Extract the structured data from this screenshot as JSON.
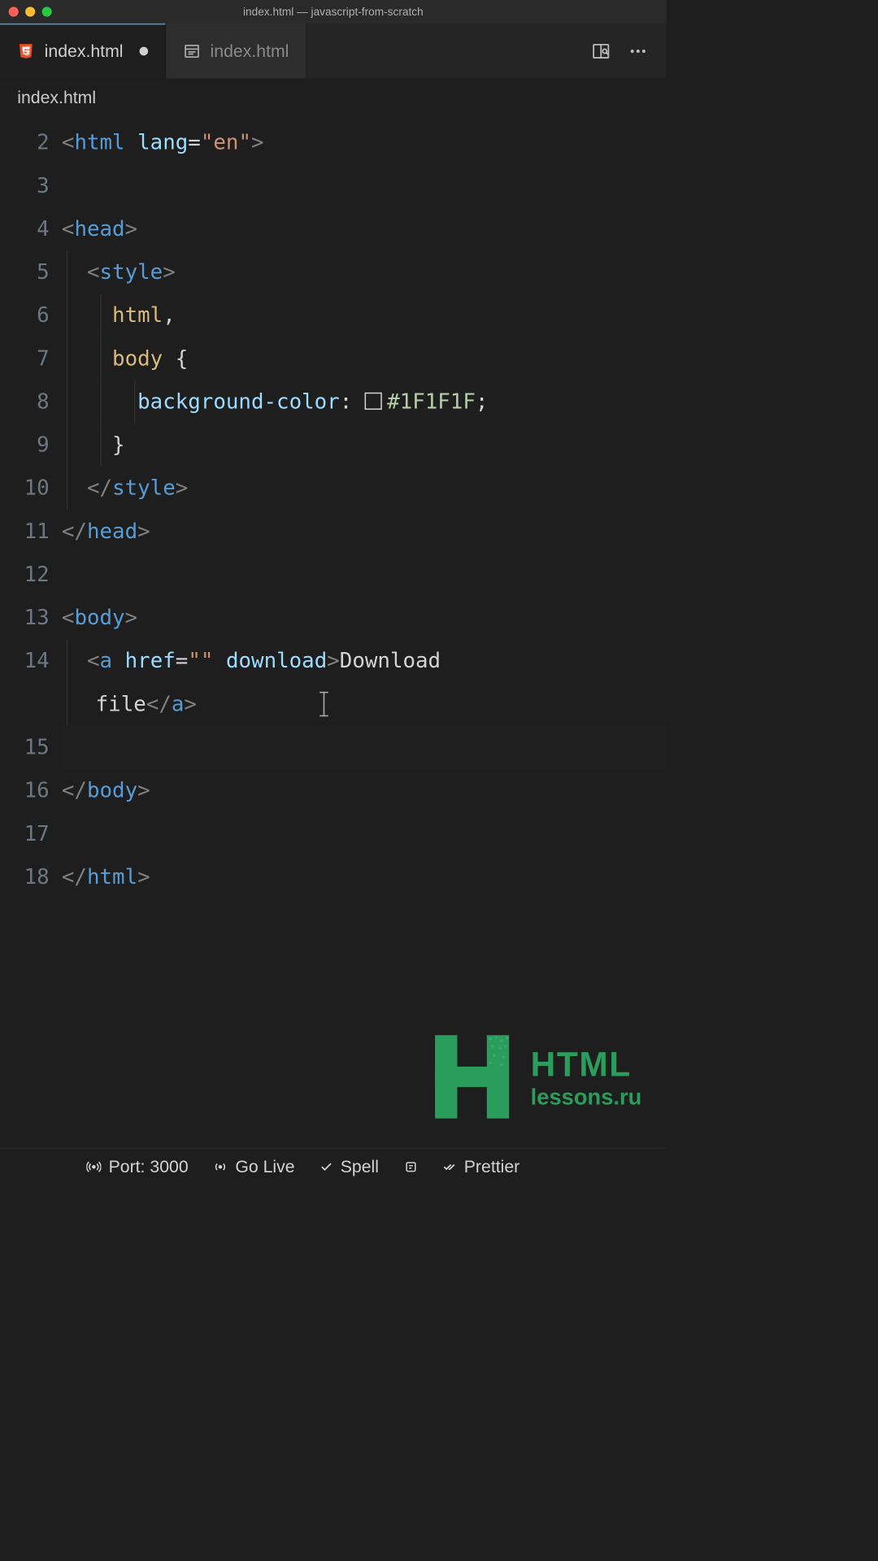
{
  "titlebar": {
    "title": "index.html — javascript-from-scratch"
  },
  "tabs": {
    "items": [
      {
        "label": "index.html",
        "icon": "html5",
        "active": true,
        "dirty": true
      },
      {
        "label": "index.html",
        "icon": "preview",
        "active": false,
        "dirty": false
      }
    ]
  },
  "breadcrumb": {
    "path": "index.html"
  },
  "editor": {
    "line_start": 2,
    "line_count": 17,
    "color_value": "#1F1F1F",
    "code_lines": [
      {
        "num": 2,
        "tokens": [
          {
            "t": "br",
            "v": "<"
          },
          {
            "t": "tag",
            "v": "html"
          },
          {
            "t": "text",
            "v": " "
          },
          {
            "t": "attr",
            "v": "lang"
          },
          {
            "t": "punc",
            "v": "="
          },
          {
            "t": "str",
            "v": "\"en\""
          },
          {
            "t": "br",
            "v": ">"
          }
        ]
      },
      {
        "num": 3,
        "tokens": []
      },
      {
        "num": 4,
        "tokens": [
          {
            "t": "br",
            "v": "<"
          },
          {
            "t": "tag",
            "v": "head"
          },
          {
            "t": "br",
            "v": ">"
          }
        ]
      },
      {
        "num": 5,
        "guides": [
          1
        ],
        "tokens": [
          {
            "t": "text",
            "v": "  "
          },
          {
            "t": "br",
            "v": "<"
          },
          {
            "t": "tag",
            "v": "style"
          },
          {
            "t": "br",
            "v": ">"
          }
        ]
      },
      {
        "num": 6,
        "guides": [
          1,
          2
        ],
        "tokens": [
          {
            "t": "text",
            "v": "    "
          },
          {
            "t": "sel",
            "v": "html"
          },
          {
            "t": "punc",
            "v": ","
          }
        ]
      },
      {
        "num": 7,
        "guides": [
          1,
          2
        ],
        "tokens": [
          {
            "t": "text",
            "v": "    "
          },
          {
            "t": "sel",
            "v": "body"
          },
          {
            "t": "text",
            "v": " "
          },
          {
            "t": "punc",
            "v": "{"
          }
        ]
      },
      {
        "num": 8,
        "guides": [
          1,
          2,
          3
        ],
        "tokens": [
          {
            "t": "text",
            "v": "      "
          },
          {
            "t": "prop",
            "v": "background-color"
          },
          {
            "t": "punc",
            "v": ": "
          },
          {
            "t": "swatch",
            "v": ""
          },
          {
            "t": "lit",
            "v": "#1F1F1F"
          },
          {
            "t": "punc",
            "v": ";"
          }
        ]
      },
      {
        "num": 9,
        "guides": [
          1,
          2
        ],
        "tokens": [
          {
            "t": "text",
            "v": "    "
          },
          {
            "t": "punc",
            "v": "}"
          }
        ]
      },
      {
        "num": 10,
        "guides": [
          1
        ],
        "tokens": [
          {
            "t": "text",
            "v": "  "
          },
          {
            "t": "br",
            "v": "</"
          },
          {
            "t": "tag",
            "v": "style"
          },
          {
            "t": "br",
            "v": ">"
          }
        ]
      },
      {
        "num": 11,
        "tokens": [
          {
            "t": "br",
            "v": "</"
          },
          {
            "t": "tag",
            "v": "head"
          },
          {
            "t": "br",
            "v": ">"
          }
        ]
      },
      {
        "num": 12,
        "tokens": []
      },
      {
        "num": 13,
        "tokens": [
          {
            "t": "br",
            "v": "<"
          },
          {
            "t": "tag",
            "v": "body"
          },
          {
            "t": "br",
            "v": ">"
          }
        ]
      },
      {
        "num": 14,
        "guides": [
          1
        ],
        "tokens": [
          {
            "t": "text",
            "v": "  "
          },
          {
            "t": "br",
            "v": "<"
          },
          {
            "t": "tag",
            "v": "a"
          },
          {
            "t": "text",
            "v": " "
          },
          {
            "t": "attr",
            "v": "href"
          },
          {
            "t": "punc",
            "v": "="
          },
          {
            "t": "str",
            "v": "\"\""
          },
          {
            "t": "text",
            "v": " "
          },
          {
            "t": "attr",
            "v": "download"
          },
          {
            "t": "br",
            "v": ">"
          },
          {
            "t": "text",
            "v": "Download "
          }
        ]
      },
      {
        "num": "14b",
        "wrap": true,
        "guides": [
          1
        ],
        "tokens": [
          {
            "t": "text",
            "v": "file"
          },
          {
            "t": "br",
            "v": "</"
          },
          {
            "t": "tag",
            "v": "a"
          },
          {
            "t": "br",
            "v": ">"
          },
          {
            "t": "caret",
            "v": ""
          }
        ]
      },
      {
        "num": 15,
        "active": true,
        "tokens": []
      },
      {
        "num": 16,
        "tokens": [
          {
            "t": "br",
            "v": "</"
          },
          {
            "t": "tag",
            "v": "body"
          },
          {
            "t": "br",
            "v": ">"
          }
        ]
      },
      {
        "num": 17,
        "tokens": []
      },
      {
        "num": 18,
        "tokens": [
          {
            "t": "br",
            "v": "</"
          },
          {
            "t": "tag",
            "v": "html"
          },
          {
            "t": "br",
            "v": ">"
          }
        ]
      }
    ]
  },
  "watermark": {
    "line1": "HTML",
    "line2": "lessons.ru"
  },
  "statusbar": {
    "port": "Port: 3000",
    "golive": "Go Live",
    "spell": "Spell",
    "prettier": "Prettier"
  }
}
